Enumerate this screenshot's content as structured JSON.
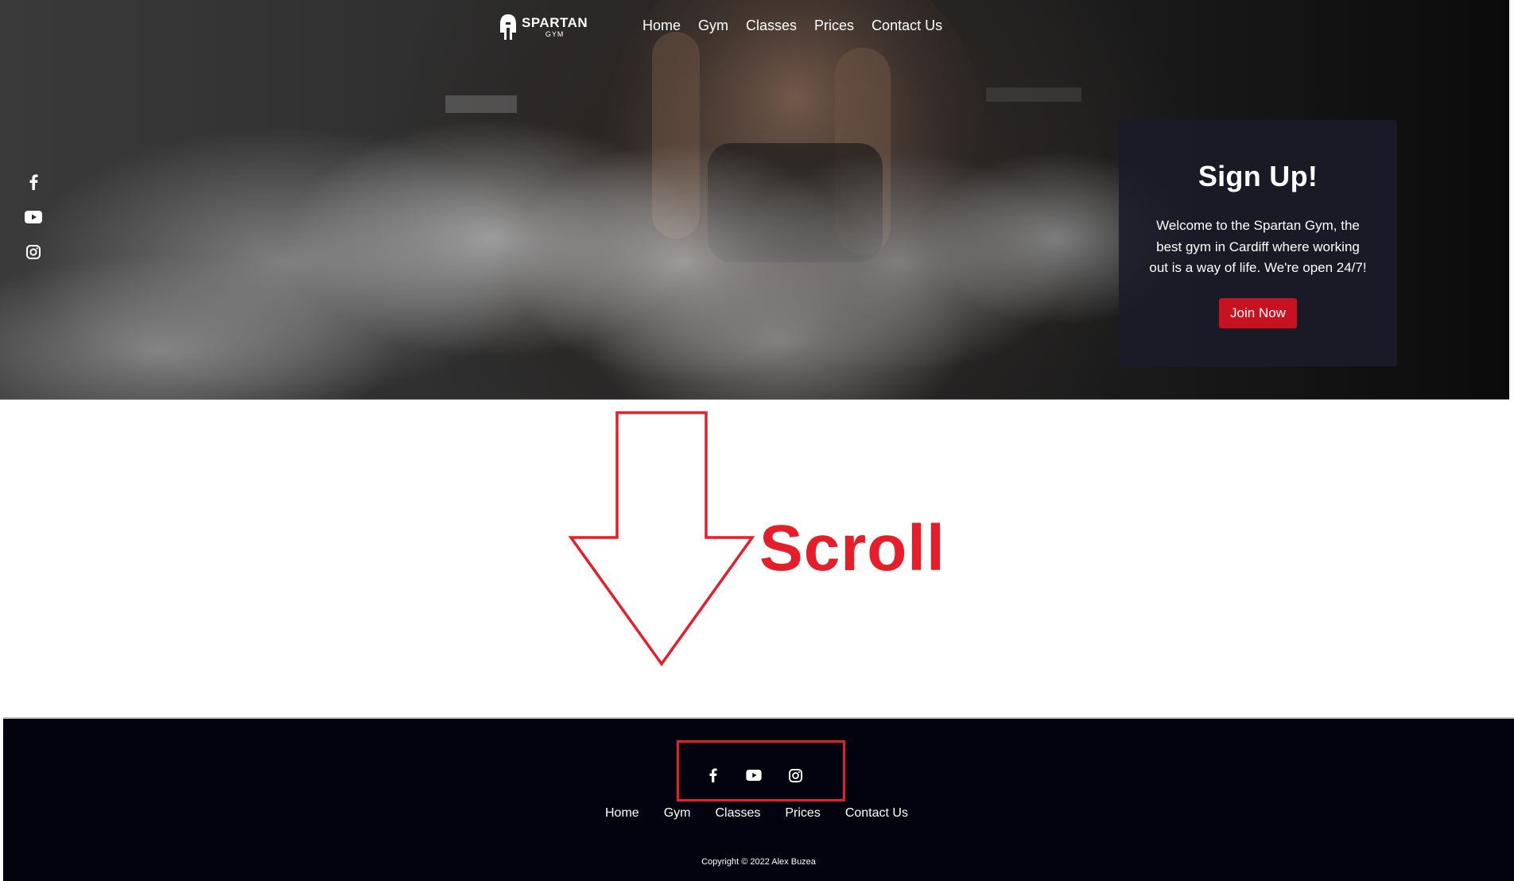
{
  "navbar": {
    "logo": {
      "title": "SPARTAN",
      "subtitle": "GYM"
    },
    "links": [
      "Home",
      "Gym",
      "Classes",
      "Prices",
      "Contact Us"
    ]
  },
  "sidebar_socials": [
    "facebook-icon",
    "youtube-icon",
    "instagram-icon"
  ],
  "signup": {
    "title": "Sign Up!",
    "text": "Welcome to the Spartan Gym, the best gym in Cardiff where working out is a way of life. We're open 24/7!",
    "button_label": "Join Now"
  },
  "annotation": {
    "label": "Scroll",
    "color": "#e61e2a"
  },
  "footer": {
    "socials": [
      "facebook-icon",
      "youtube-icon",
      "instagram-icon"
    ],
    "links": [
      "Home",
      "Gym",
      "Classes",
      "Prices",
      "Contact Us"
    ],
    "copyright": "Copyright © 2022 Alex Buzea"
  },
  "colors": {
    "accent": "#c8121f",
    "footer_bg": "#03030f",
    "card_bg": "#1a1b28"
  }
}
